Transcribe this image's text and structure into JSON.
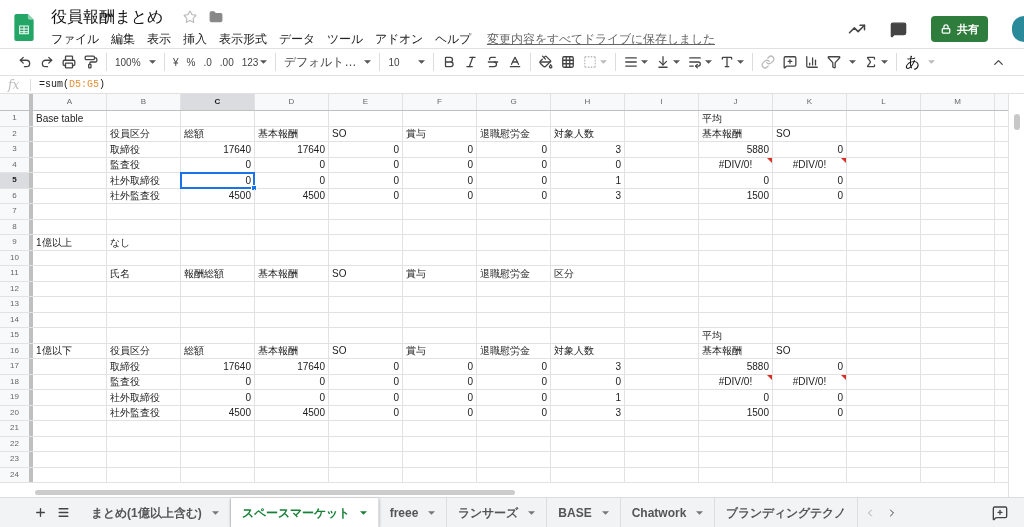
{
  "document": {
    "title": "役員報酬まとめ",
    "menu": [
      "ファイル",
      "編集",
      "表示",
      "挿入",
      "表示形式",
      "データ",
      "ツール",
      "アドオン",
      "ヘルプ"
    ],
    "save_status": "変更内容をすべてドライブに保存しました",
    "share_button": "共有"
  },
  "toolbar": {
    "zoom": "100%",
    "currency": "¥",
    "percent": "%",
    "decrease_decimals": ".0",
    "increase_decimals": ".00",
    "more_formats": "123",
    "font": "デフォルト…",
    "font_size": "10",
    "input_tools": "あ"
  },
  "formula_bar": {
    "label": "fx",
    "formula_start": "=sum(",
    "formula_range": "D5:G5",
    "formula_end": ")"
  },
  "grid": {
    "columns": [
      {
        "label": "A",
        "selected": false
      },
      {
        "label": "B",
        "selected": false
      },
      {
        "label": "C",
        "selected": true
      },
      {
        "label": "D",
        "selected": false
      },
      {
        "label": "E",
        "selected": false
      },
      {
        "label": "F",
        "selected": false
      },
      {
        "label": "G",
        "selected": false
      },
      {
        "label": "H",
        "selected": false
      },
      {
        "label": "I",
        "selected": false
      },
      {
        "label": "J",
        "selected": false
      },
      {
        "label": "K",
        "selected": false
      },
      {
        "label": "L",
        "selected": false
      },
      {
        "label": "M",
        "selected": false
      }
    ],
    "rows": [
      {
        "number": "1",
        "selected": false,
        "cells": [
          {
            "text": "Base table",
            "kind": "text"
          },
          "",
          "",
          "",
          "",
          "",
          "",
          "",
          "",
          {
            "text": "平均",
            "kind": "text"
          },
          "",
          "",
          ""
        ]
      },
      {
        "number": "2",
        "selected": false,
        "cells": [
          "",
          {
            "text": "役員区分",
            "kind": "text"
          },
          {
            "text": "総額",
            "kind": "text"
          },
          {
            "text": "基本報酬",
            "kind": "text"
          },
          {
            "text": "SO",
            "kind": "text"
          },
          {
            "text": "賞与",
            "kind": "text"
          },
          {
            "text": "退職慰労金",
            "kind": "text"
          },
          {
            "text": "対象人数",
            "kind": "text"
          },
          "",
          {
            "text": "基本報酬",
            "kind": "text"
          },
          {
            "text": "SO",
            "kind": "text"
          },
          "",
          ""
        ]
      },
      {
        "number": "3",
        "selected": false,
        "cells": [
          "",
          {
            "text": "取締役",
            "kind": "text"
          },
          {
            "text": "17640",
            "kind": "number"
          },
          {
            "text": "17640",
            "kind": "number"
          },
          {
            "text": "0",
            "kind": "number"
          },
          {
            "text": "0",
            "kind": "number"
          },
          {
            "text": "0",
            "kind": "number"
          },
          {
            "text": "3",
            "kind": "number"
          },
          "",
          {
            "text": "5880",
            "kind": "number"
          },
          {
            "text": "0",
            "kind": "number"
          },
          "",
          ""
        ]
      },
      {
        "number": "4",
        "selected": false,
        "cells": [
          "",
          {
            "text": "監査役",
            "kind": "text"
          },
          {
            "text": "0",
            "kind": "number"
          },
          {
            "text": "0",
            "kind": "number"
          },
          {
            "text": "0",
            "kind": "number"
          },
          {
            "text": "0",
            "kind": "number"
          },
          {
            "text": "0",
            "kind": "number"
          },
          {
            "text": "0",
            "kind": "number"
          },
          "",
          {
            "text": "#DIV/0!",
            "kind": "error"
          },
          {
            "text": "#DIV/0!",
            "kind": "error"
          },
          "",
          ""
        ]
      },
      {
        "number": "5",
        "selected": true,
        "cells": [
          "",
          {
            "text": "社外取締役",
            "kind": "text"
          },
          {
            "text": "0",
            "kind": "number"
          },
          {
            "text": "0",
            "kind": "number"
          },
          {
            "text": "0",
            "kind": "number"
          },
          {
            "text": "0",
            "kind": "number"
          },
          {
            "text": "0",
            "kind": "number"
          },
          {
            "text": "1",
            "kind": "number"
          },
          "",
          {
            "text": "0",
            "kind": "number"
          },
          {
            "text": "0",
            "kind": "number"
          },
          "",
          ""
        ]
      },
      {
        "number": "6",
        "selected": false,
        "cells": [
          "",
          {
            "text": "社外監査役",
            "kind": "text"
          },
          {
            "text": "4500",
            "kind": "number"
          },
          {
            "text": "4500",
            "kind": "number"
          },
          {
            "text": "0",
            "kind": "number"
          },
          {
            "text": "0",
            "kind": "number"
          },
          {
            "text": "0",
            "kind": "number"
          },
          {
            "text": "3",
            "kind": "number"
          },
          "",
          {
            "text": "1500",
            "kind": "number"
          },
          {
            "text": "0",
            "kind": "number"
          },
          "",
          ""
        ]
      },
      {
        "number": "7",
        "selected": false,
        "cells": []
      },
      {
        "number": "8",
        "selected": false,
        "cells": []
      },
      {
        "number": "9",
        "selected": false,
        "cells": [
          {
            "text": "1億以上",
            "kind": "text"
          },
          {
            "text": "なし",
            "kind": "text"
          }
        ]
      },
      {
        "number": "10",
        "selected": false,
        "cells": []
      },
      {
        "number": "11",
        "selected": false,
        "cells": [
          "",
          {
            "text": "氏名",
            "kind": "text"
          },
          {
            "text": "報酬総額",
            "kind": "text"
          },
          {
            "text": "基本報酬",
            "kind": "text"
          },
          {
            "text": "SO",
            "kind": "text"
          },
          {
            "text": "賞与",
            "kind": "text"
          },
          {
            "text": "退職慰労金",
            "kind": "text"
          },
          {
            "text": "区分",
            "kind": "text"
          }
        ]
      },
      {
        "number": "12",
        "selected": false,
        "cells": []
      },
      {
        "number": "13",
        "selected": false,
        "cells": []
      },
      {
        "number": "14",
        "selected": false,
        "cells": []
      },
      {
        "number": "15",
        "selected": false,
        "cells": [
          "",
          "",
          "",
          "",
          "",
          "",
          "",
          "",
          "",
          {
            "text": "平均",
            "kind": "text"
          }
        ]
      },
      {
        "number": "16",
        "selected": false,
        "cells": [
          {
            "text": "1億以下",
            "kind": "text"
          },
          {
            "text": "役員区分",
            "kind": "text"
          },
          {
            "text": "総額",
            "kind": "text"
          },
          {
            "text": "基本報酬",
            "kind": "text"
          },
          {
            "text": "SO",
            "kind": "text"
          },
          {
            "text": "賞与",
            "kind": "text"
          },
          {
            "text": "退職慰労金",
            "kind": "text"
          },
          {
            "text": "対象人数",
            "kind": "text"
          },
          "",
          {
            "text": "基本報酬",
            "kind": "text"
          },
          {
            "text": "SO",
            "kind": "text"
          },
          "",
          ""
        ]
      },
      {
        "number": "17",
        "selected": false,
        "cells": [
          "",
          {
            "text": "取締役",
            "kind": "text"
          },
          {
            "text": "17640",
            "kind": "number"
          },
          {
            "text": "17640",
            "kind": "number"
          },
          {
            "text": "0",
            "kind": "number"
          },
          {
            "text": "0",
            "kind": "number"
          },
          {
            "text": "0",
            "kind": "number"
          },
          {
            "text": "3",
            "kind": "number"
          },
          "",
          {
            "text": "5880",
            "kind": "number"
          },
          {
            "text": "0",
            "kind": "number"
          },
          "",
          ""
        ]
      },
      {
        "number": "18",
        "selected": false,
        "cells": [
          "",
          {
            "text": "監査役",
            "kind": "text"
          },
          {
            "text": "0",
            "kind": "number"
          },
          {
            "text": "0",
            "kind": "number"
          },
          {
            "text": "0",
            "kind": "number"
          },
          {
            "text": "0",
            "kind": "number"
          },
          {
            "text": "0",
            "kind": "number"
          },
          {
            "text": "0",
            "kind": "number"
          },
          "",
          {
            "text": "#DIV/0!",
            "kind": "error"
          },
          {
            "text": "#DIV/0!",
            "kind": "error"
          },
          "",
          ""
        ]
      },
      {
        "number": "19",
        "selected": false,
        "cells": [
          "",
          {
            "text": "社外取締役",
            "kind": "text"
          },
          {
            "text": "0",
            "kind": "number"
          },
          {
            "text": "0",
            "kind": "number"
          },
          {
            "text": "0",
            "kind": "number"
          },
          {
            "text": "0",
            "kind": "number"
          },
          {
            "text": "0",
            "kind": "number"
          },
          {
            "text": "1",
            "kind": "number"
          },
          "",
          {
            "text": "0",
            "kind": "number"
          },
          {
            "text": "0",
            "kind": "number"
          },
          "",
          ""
        ]
      },
      {
        "number": "20",
        "selected": false,
        "cells": [
          "",
          {
            "text": "社外監査役",
            "kind": "text"
          },
          {
            "text": "4500",
            "kind": "number"
          },
          {
            "text": "4500",
            "kind": "number"
          },
          {
            "text": "0",
            "kind": "number"
          },
          {
            "text": "0",
            "kind": "number"
          },
          {
            "text": "0",
            "kind": "number"
          },
          {
            "text": "3",
            "kind": "number"
          },
          "",
          {
            "text": "1500",
            "kind": "number"
          },
          {
            "text": "0",
            "kind": "number"
          },
          "",
          ""
        ]
      },
      {
        "number": "21",
        "selected": false,
        "cells": []
      },
      {
        "number": "22",
        "selected": false,
        "cells": []
      },
      {
        "number": "23",
        "selected": false,
        "cells": []
      },
      {
        "number": "24",
        "selected": false,
        "cells": []
      }
    ]
  },
  "sheet_tabs": [
    {
      "label": "まとめ(1億以上含む)",
      "selected": false
    },
    {
      "label": "スペースマーケット",
      "selected": true
    },
    {
      "label": "freee",
      "selected": false
    },
    {
      "label": "ランサーズ",
      "selected": false
    },
    {
      "label": "BASE",
      "selected": false
    },
    {
      "label": "Chatwork",
      "selected": false
    },
    {
      "label": "ブランディングテクノ",
      "selected": false
    }
  ]
}
